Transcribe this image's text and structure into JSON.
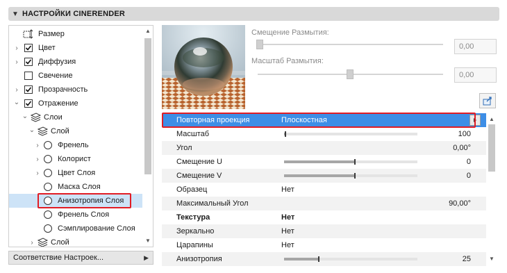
{
  "header": {
    "title": "НАСТРОЙКИ CINERENDER"
  },
  "tree": {
    "items": [
      {
        "label": "Размер"
      },
      {
        "label": "Цвет"
      },
      {
        "label": "Диффузия"
      },
      {
        "label": "Свечение"
      },
      {
        "label": "Прозрачность"
      },
      {
        "label": "Отражение"
      },
      {
        "label": "Слои"
      },
      {
        "label": "Слой"
      },
      {
        "label": "Френель"
      },
      {
        "label": "Колорист"
      },
      {
        "label": "Цвет Слоя"
      },
      {
        "label": "Маска Слоя"
      },
      {
        "label": "Анизотропия Слоя"
      },
      {
        "label": "Френель Слоя"
      },
      {
        "label": "Сэмплирование Слоя"
      },
      {
        "label": "Слой"
      }
    ]
  },
  "match_dropdown": {
    "label": "Соответствие Настроек..."
  },
  "blur": {
    "offset_label": "Смещение Размытия:",
    "offset_value": "0,00",
    "scale_label": "Масштаб Размытия:",
    "scale_value": "0,00"
  },
  "properties": [
    {
      "name": "Повторная проекция",
      "value": "Плоскостная"
    },
    {
      "name": "Масштаб",
      "number": "100",
      "fraction": 0.01
    },
    {
      "name": "Угол",
      "number": "0,00°"
    },
    {
      "name": "Смещение U",
      "number": "0",
      "fraction": 0.53
    },
    {
      "name": "Смещение V",
      "number": "0",
      "fraction": 0.53
    },
    {
      "name": "Образец",
      "value": "Нет"
    },
    {
      "name": "Максимальный Угол",
      "number": "90,00°"
    },
    {
      "name": "Текстура",
      "value": "Нет"
    },
    {
      "name": "Зеркально",
      "value": "Нет"
    },
    {
      "name": "Царапины",
      "value": "Нет"
    },
    {
      "name": "Анизотропия",
      "number": "25",
      "fraction": 0.26
    }
  ],
  "colors": {
    "selection_blue": "#3d8ee6",
    "tree_selection": "#cde3f7",
    "highlight_red": "#e11c24"
  }
}
